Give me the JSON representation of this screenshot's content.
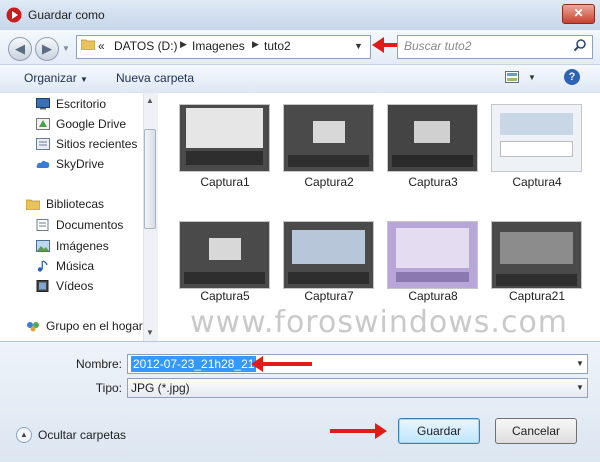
{
  "window": {
    "title": "Guardar como",
    "close_symbol": "✕"
  },
  "address": {
    "overflow": "«",
    "crumbs": [
      "DATOS (D:)",
      "Imagenes",
      "tuto2"
    ],
    "search_placeholder": "Buscar tuto2"
  },
  "toolbar": {
    "organize": "Organizar",
    "new_folder": "Nueva carpeta",
    "help": "?"
  },
  "nav": {
    "items": [
      "Escritorio",
      "Google Drive",
      "Sitios recientes",
      "SkyDrive",
      "Bibliotecas",
      "Documentos",
      "Imágenes",
      "Música",
      "Vídeos",
      "Grupo en el hogar"
    ]
  },
  "files": [
    "Captura1",
    "Captura2",
    "Captura3",
    "Captura4",
    "Captura5",
    "Captura7",
    "Captura8",
    "Captura21"
  ],
  "watermark": "www.foroswindows.com",
  "form": {
    "name_label": "Nombre:",
    "name_value": "2012-07-23_21h28_21",
    "type_label": "Tipo:",
    "type_value": "JPG (*.jpg)",
    "hide_folders": "Ocultar carpetas",
    "save": "Guardar",
    "cancel": "Cancelar"
  },
  "colors": {
    "annotation_arrow": "#e11a1a",
    "selection": "#3399ff"
  }
}
